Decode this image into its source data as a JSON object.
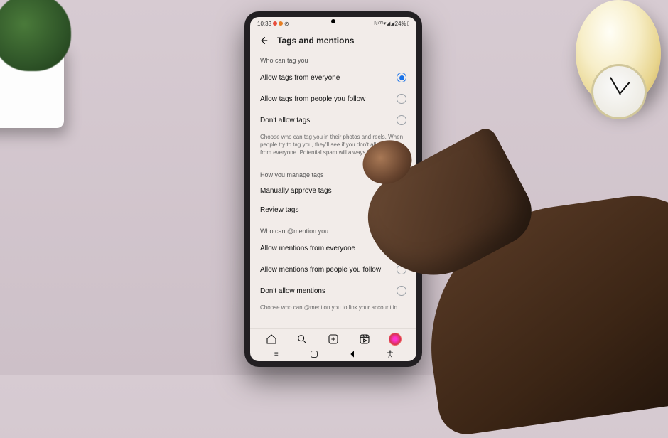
{
  "status": {
    "time": "10:33",
    "battery_text": "24%"
  },
  "header": {
    "title": "Tags and mentions"
  },
  "sections": {
    "tag_label": "Who can tag you",
    "tag_options": {
      "everyone": "Allow tags from everyone",
      "following": "Allow tags from people you follow",
      "none": "Don't allow tags"
    },
    "tag_help": "Choose who can tag you in their photos and reels. When people try to tag you, they'll see if you don't allow tags from everyone. Potential spam will always be filtered.",
    "manage_label": "How you manage tags",
    "manage_row": "Manually approve tags",
    "review_row": "Review tags",
    "mention_label": "Who can @mention you",
    "mention_options": {
      "everyone": "Allow mentions from everyone",
      "following": "Allow mentions from people you follow",
      "none": "Don't allow mentions"
    },
    "mention_help_truncated": "Choose who can @mention you to link your account in"
  },
  "state": {
    "tag_selected": "everyone",
    "manually_approve": true,
    "mention_selected": "everyone"
  }
}
